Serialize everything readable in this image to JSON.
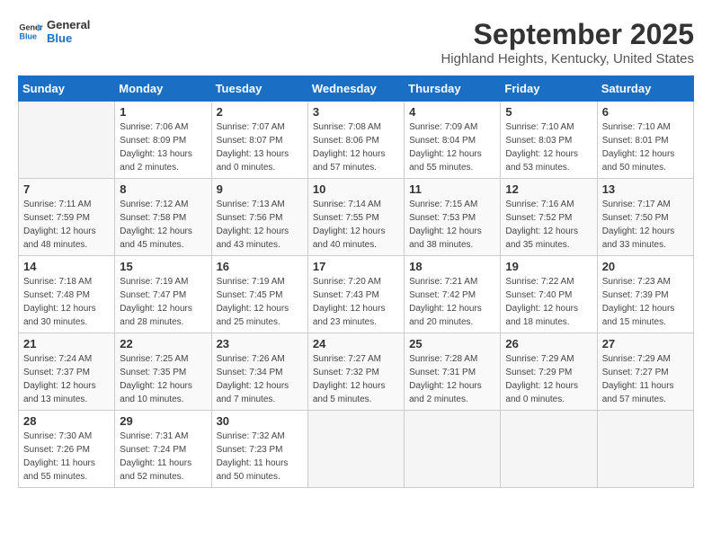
{
  "logo": {
    "text_general": "General",
    "text_blue": "Blue"
  },
  "title": "September 2025",
  "location": "Highland Heights, Kentucky, United States",
  "days_of_week": [
    "Sunday",
    "Monday",
    "Tuesday",
    "Wednesday",
    "Thursday",
    "Friday",
    "Saturday"
  ],
  "weeks": [
    [
      {
        "num": "",
        "info": ""
      },
      {
        "num": "1",
        "info": "Sunrise: 7:06 AM\nSunset: 8:09 PM\nDaylight: 13 hours\nand 2 minutes."
      },
      {
        "num": "2",
        "info": "Sunrise: 7:07 AM\nSunset: 8:07 PM\nDaylight: 13 hours\nand 0 minutes."
      },
      {
        "num": "3",
        "info": "Sunrise: 7:08 AM\nSunset: 8:06 PM\nDaylight: 12 hours\nand 57 minutes."
      },
      {
        "num": "4",
        "info": "Sunrise: 7:09 AM\nSunset: 8:04 PM\nDaylight: 12 hours\nand 55 minutes."
      },
      {
        "num": "5",
        "info": "Sunrise: 7:10 AM\nSunset: 8:03 PM\nDaylight: 12 hours\nand 53 minutes."
      },
      {
        "num": "6",
        "info": "Sunrise: 7:10 AM\nSunset: 8:01 PM\nDaylight: 12 hours\nand 50 minutes."
      }
    ],
    [
      {
        "num": "7",
        "info": "Sunrise: 7:11 AM\nSunset: 7:59 PM\nDaylight: 12 hours\nand 48 minutes."
      },
      {
        "num": "8",
        "info": "Sunrise: 7:12 AM\nSunset: 7:58 PM\nDaylight: 12 hours\nand 45 minutes."
      },
      {
        "num": "9",
        "info": "Sunrise: 7:13 AM\nSunset: 7:56 PM\nDaylight: 12 hours\nand 43 minutes."
      },
      {
        "num": "10",
        "info": "Sunrise: 7:14 AM\nSunset: 7:55 PM\nDaylight: 12 hours\nand 40 minutes."
      },
      {
        "num": "11",
        "info": "Sunrise: 7:15 AM\nSunset: 7:53 PM\nDaylight: 12 hours\nand 38 minutes."
      },
      {
        "num": "12",
        "info": "Sunrise: 7:16 AM\nSunset: 7:52 PM\nDaylight: 12 hours\nand 35 minutes."
      },
      {
        "num": "13",
        "info": "Sunrise: 7:17 AM\nSunset: 7:50 PM\nDaylight: 12 hours\nand 33 minutes."
      }
    ],
    [
      {
        "num": "14",
        "info": "Sunrise: 7:18 AM\nSunset: 7:48 PM\nDaylight: 12 hours\nand 30 minutes."
      },
      {
        "num": "15",
        "info": "Sunrise: 7:19 AM\nSunset: 7:47 PM\nDaylight: 12 hours\nand 28 minutes."
      },
      {
        "num": "16",
        "info": "Sunrise: 7:19 AM\nSunset: 7:45 PM\nDaylight: 12 hours\nand 25 minutes."
      },
      {
        "num": "17",
        "info": "Sunrise: 7:20 AM\nSunset: 7:43 PM\nDaylight: 12 hours\nand 23 minutes."
      },
      {
        "num": "18",
        "info": "Sunrise: 7:21 AM\nSunset: 7:42 PM\nDaylight: 12 hours\nand 20 minutes."
      },
      {
        "num": "19",
        "info": "Sunrise: 7:22 AM\nSunset: 7:40 PM\nDaylight: 12 hours\nand 18 minutes."
      },
      {
        "num": "20",
        "info": "Sunrise: 7:23 AM\nSunset: 7:39 PM\nDaylight: 12 hours\nand 15 minutes."
      }
    ],
    [
      {
        "num": "21",
        "info": "Sunrise: 7:24 AM\nSunset: 7:37 PM\nDaylight: 12 hours\nand 13 minutes."
      },
      {
        "num": "22",
        "info": "Sunrise: 7:25 AM\nSunset: 7:35 PM\nDaylight: 12 hours\nand 10 minutes."
      },
      {
        "num": "23",
        "info": "Sunrise: 7:26 AM\nSunset: 7:34 PM\nDaylight: 12 hours\nand 7 minutes."
      },
      {
        "num": "24",
        "info": "Sunrise: 7:27 AM\nSunset: 7:32 PM\nDaylight: 12 hours\nand 5 minutes."
      },
      {
        "num": "25",
        "info": "Sunrise: 7:28 AM\nSunset: 7:31 PM\nDaylight: 12 hours\nand 2 minutes."
      },
      {
        "num": "26",
        "info": "Sunrise: 7:29 AM\nSunset: 7:29 PM\nDaylight: 12 hours\nand 0 minutes."
      },
      {
        "num": "27",
        "info": "Sunrise: 7:29 AM\nSunset: 7:27 PM\nDaylight: 11 hours\nand 57 minutes."
      }
    ],
    [
      {
        "num": "28",
        "info": "Sunrise: 7:30 AM\nSunset: 7:26 PM\nDaylight: 11 hours\nand 55 minutes."
      },
      {
        "num": "29",
        "info": "Sunrise: 7:31 AM\nSunset: 7:24 PM\nDaylight: 11 hours\nand 52 minutes."
      },
      {
        "num": "30",
        "info": "Sunrise: 7:32 AM\nSunset: 7:23 PM\nDaylight: 11 hours\nand 50 minutes."
      },
      {
        "num": "",
        "info": ""
      },
      {
        "num": "",
        "info": ""
      },
      {
        "num": "",
        "info": ""
      },
      {
        "num": "",
        "info": ""
      }
    ]
  ]
}
